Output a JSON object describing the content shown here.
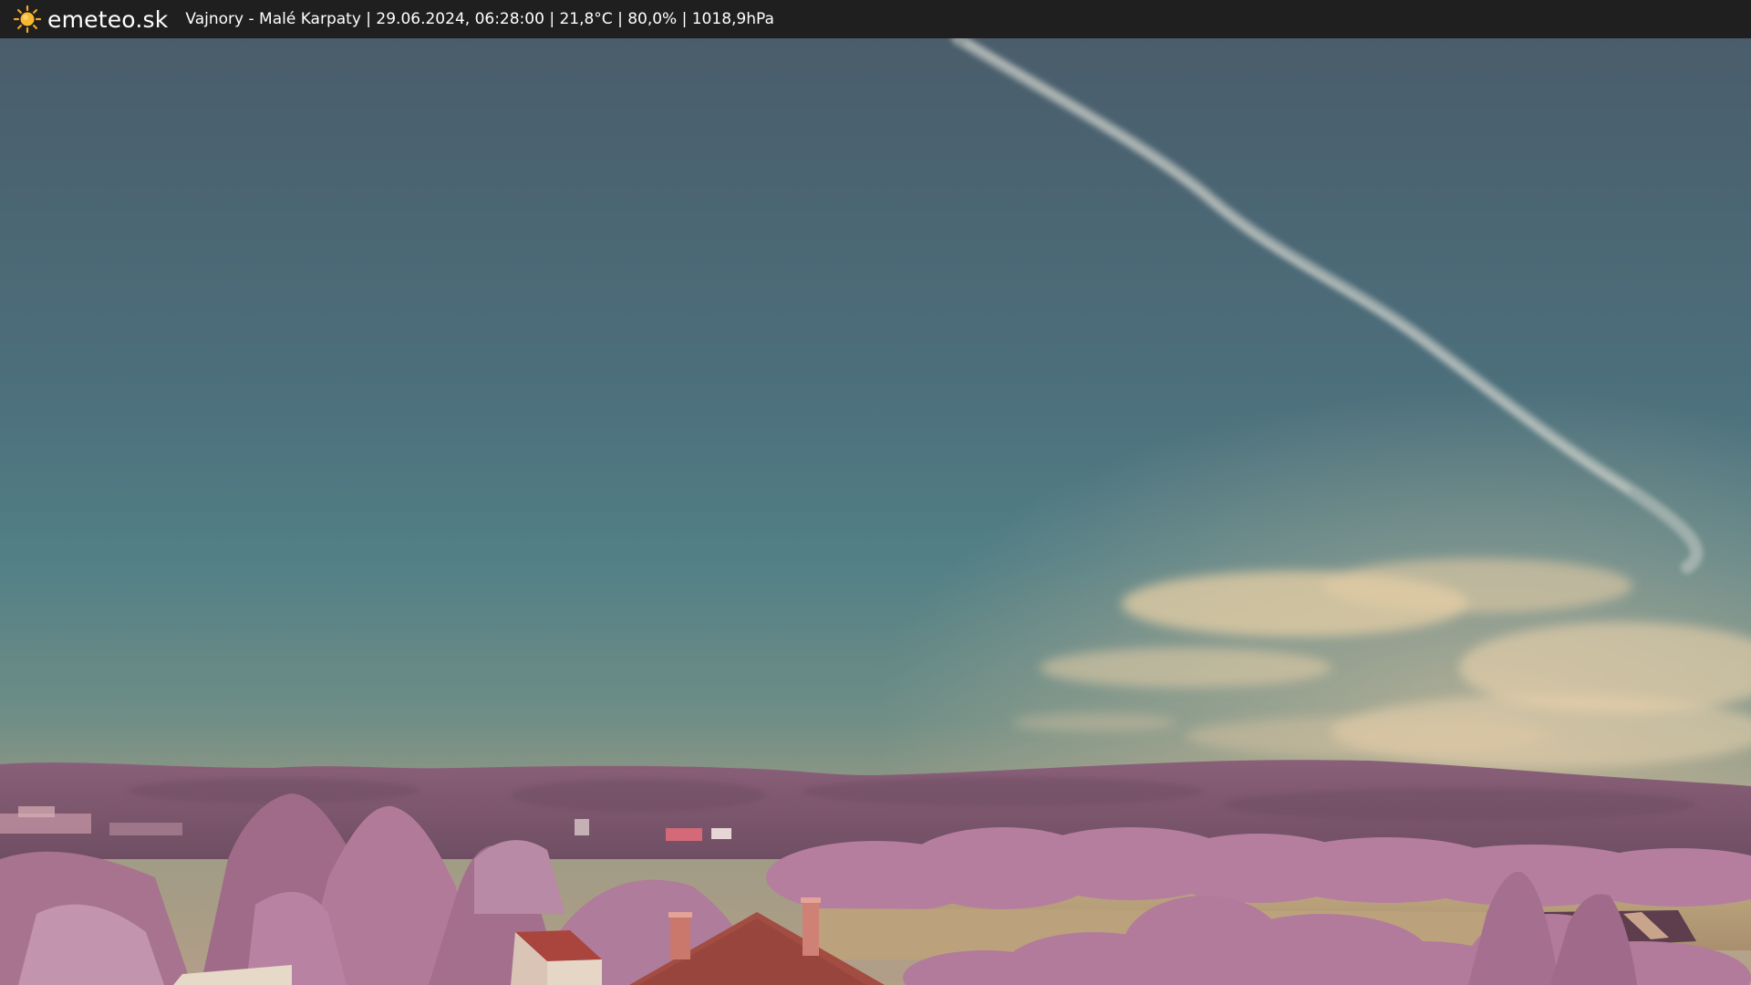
{
  "header": {
    "brand": "emeteo.sk",
    "brand_icon": "sun-icon",
    "caption": "Vajnory - Malé Karpaty | 29.06.2024, 06:28:00 | 21,8°C | 80,0% | 1018,9hPa"
  },
  "colors": {
    "topbar": "#1f1f1f",
    "sun": "#f5a623",
    "sky_top": "#4a5f6d",
    "sky_mid": "#4d7b86",
    "sky_horizon": "#8c9a86",
    "foliage": "#b07a9c",
    "hills": "#7d5a6f",
    "field": "#b7a07c",
    "roof": "#a9453d"
  }
}
